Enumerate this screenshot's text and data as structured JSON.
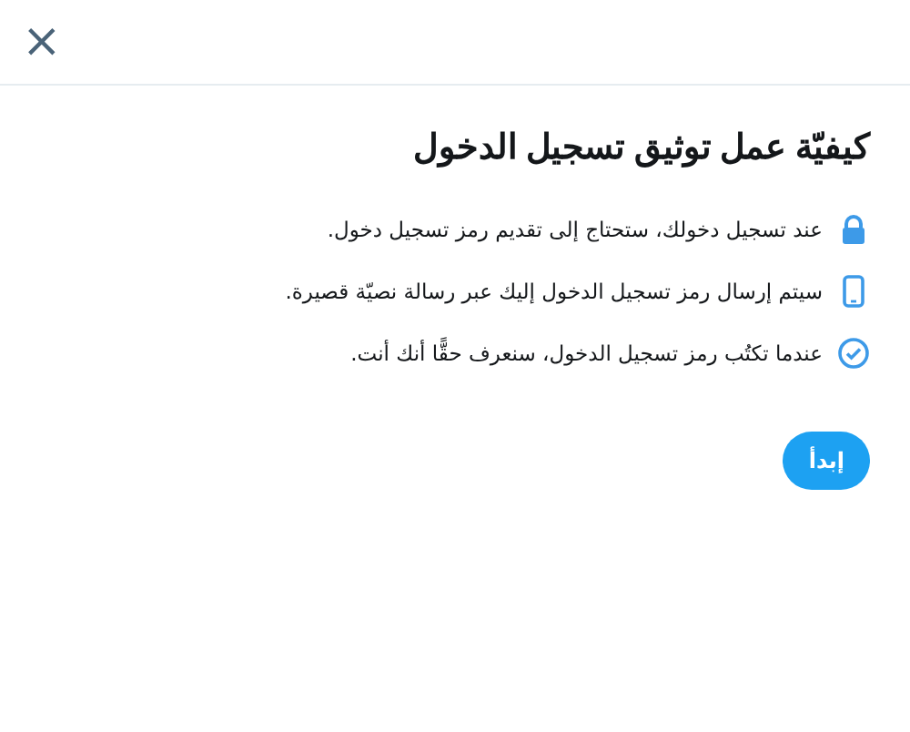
{
  "close_button": {
    "label": "×"
  },
  "title": "كيفيّة عمل توثيق تسجيل الدخول",
  "steps": [
    {
      "kind": "lock",
      "text": "عند تسجيل دخولك، ستحتاج إلى تقديم رمز تسجيل دخول."
    },
    {
      "kind": "phone",
      "text": "سيتم إرسال رمز تسجيل الدخول إليك عبر رسالة نصيّة قصيرة."
    },
    {
      "kind": "check",
      "text": "عندما تكتُب رمز تسجيل الدخول، سنعرف حقًّا أنك أنت."
    }
  ],
  "start_button": {
    "label": "إبدأ"
  }
}
